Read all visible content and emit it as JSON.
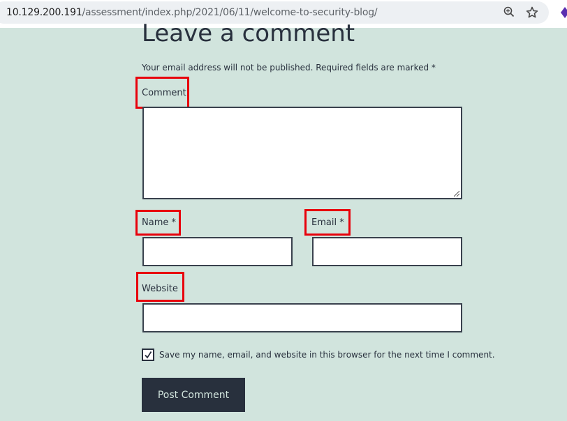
{
  "browser": {
    "url_host": "10.129.200.191",
    "url_path": "/assessment/index.php/2021/06/11/welcome-to-security-blog/",
    "zoom_icon": "zoom-in-icon",
    "bookmark_icon": "star-icon"
  },
  "comment_form": {
    "title": "Leave a comment",
    "notes": "Your email address will not be published. Required fields are marked *",
    "comment_label": "Comment",
    "name_label": "Name *",
    "email_label": "Email *",
    "website_label": "Website",
    "comment_value": "",
    "name_value": "",
    "email_value": "",
    "website_value": "",
    "cookies_consent_checked": true,
    "cookies_consent_label": "Save my name, email, and website in this browser for the next time I comment.",
    "submit_label": "Post Comment"
  },
  "colors": {
    "page_background": "#d1e4dd",
    "text": "#28303d",
    "highlight": "#e8000b"
  }
}
